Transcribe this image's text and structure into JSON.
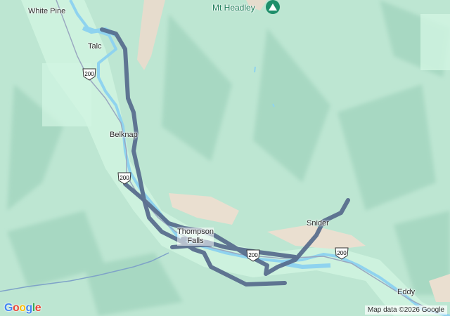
{
  "map": {
    "places": [
      {
        "name": "White Pine"
      },
      {
        "name": "Talc"
      },
      {
        "name": "Belknap"
      },
      {
        "name": "Thompson Falls"
      },
      {
        "name": "Snider"
      },
      {
        "name": "Eddy"
      }
    ],
    "thompson_falls_line1": "Thompson",
    "thompson_falls_line2": "Falls",
    "peak": {
      "name": "Mt Headley",
      "icon": "mountain-peak-icon"
    },
    "route_shields": [
      "200",
      "200",
      "200",
      "200"
    ],
    "colors": {
      "terrain": "#bfe8d5",
      "terrain_dark": "#9bd1bb",
      "valley": "#c8f0dc",
      "bare_ground": "#e8ded1",
      "water": "#8fd3ef",
      "route": "#5b6f8c",
      "peak": "#1e8e6a"
    }
  },
  "attribution": "Map data ©2026 Google",
  "logo": {
    "letters": [
      "G",
      "o",
      "o",
      "g",
      "l",
      "e"
    ],
    "colors": [
      "#4285F4",
      "#EA4335",
      "#FBBC05",
      "#4285F4",
      "#34A853",
      "#EA4335"
    ]
  }
}
